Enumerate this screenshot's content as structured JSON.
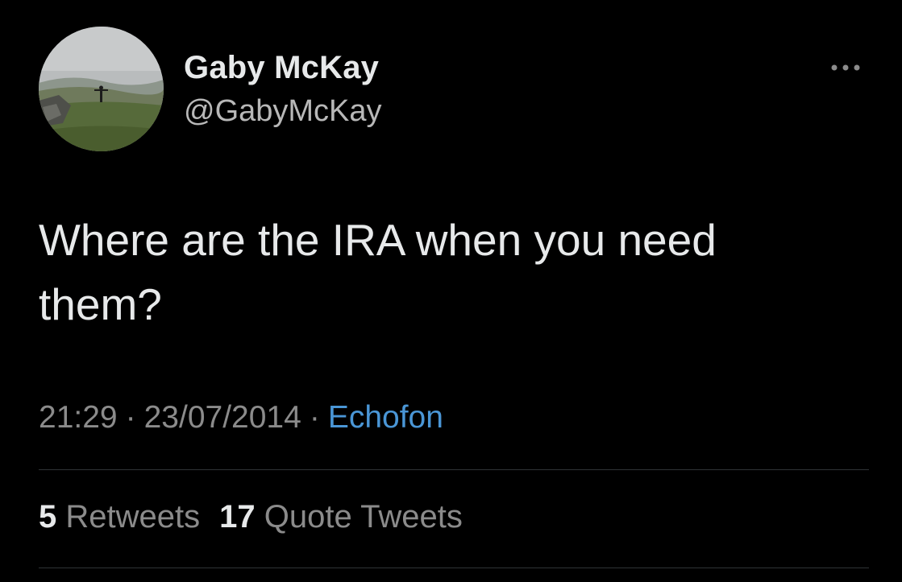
{
  "author": {
    "display_name": "Gaby McKay",
    "handle": "@GabyMcKay",
    "avatar_icon": "profile-photo-landscape-person"
  },
  "more_icon": "ellipsis-icon",
  "tweet": {
    "line1": "Where are the IRA when you need",
    "line2": "them?"
  },
  "meta": {
    "time": "21:29",
    "separator": "·",
    "date": "23/07/2014",
    "source": "Echofon"
  },
  "stats": {
    "retweets_count": "5",
    "retweets_label": "Retweets",
    "quotes_count": "17",
    "quotes_label": "Quote Tweets"
  },
  "colors": {
    "background": "#000000",
    "primary_text": "#e7e9ea",
    "secondary_text": "#8b8b8b",
    "link": "#4a96d6",
    "divider": "#2f3336"
  }
}
